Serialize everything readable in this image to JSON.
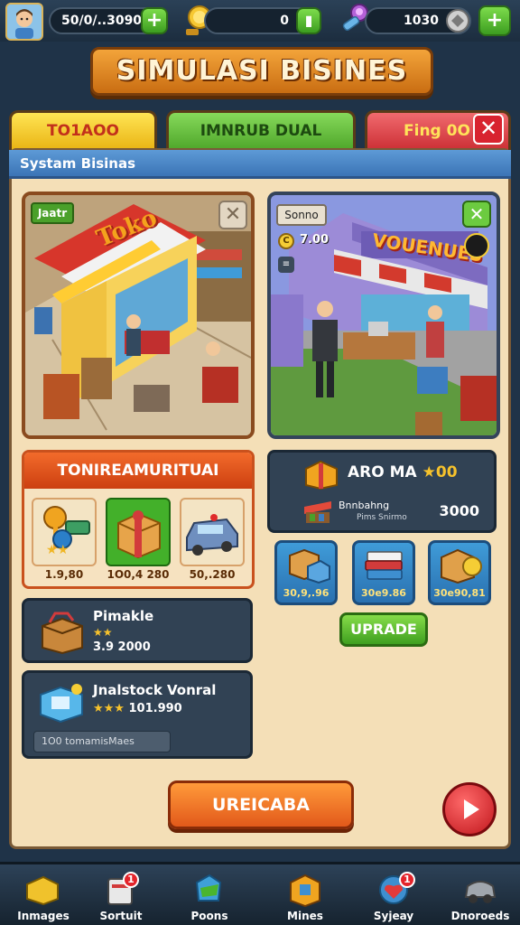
{
  "resources": {
    "cash": "50/0/..3090",
    "coins": "0",
    "gems": "1030"
  },
  "title": "SIMULASI BISINES",
  "tabs": [
    {
      "label": "TO1AOO",
      "color": "#f5d02b"
    },
    {
      "label": "IMNRUB DUAL",
      "color": "#6cc844"
    },
    {
      "label": "Fing 0O",
      "color": "#e2454a"
    }
  ],
  "subheader": "Systam Bisinas",
  "scene_left": {
    "tag": "Jaatr",
    "sign": "Toko"
  },
  "scene_right": {
    "tag": "Sonno",
    "coin_value": "7.00",
    "sign": "VOUENUES"
  },
  "feature_panel": {
    "title": "TONIREAMURITUAI",
    "items": [
      {
        "icon": "key-icon",
        "price": "1.9,80",
        "stars": "★★"
      },
      {
        "icon": "gift-box-icon",
        "price": "1O0,4 280"
      },
      {
        "icon": "car-icon",
        "price": "50,.280"
      }
    ]
  },
  "list_items": [
    {
      "title": "Pimakle",
      "stars": "★★",
      "value": "3.9 2000"
    },
    {
      "title": "Jnalstock Vonral",
      "stars": "★★★",
      "value": "101.990",
      "note": "1O0 tomamisMaes"
    }
  ],
  "right_card": {
    "title": "ARO MA",
    "title_value": "00",
    "sub_label": "Bnnbahng",
    "sub_detail": "Pims Snirmo",
    "value": "3000"
  },
  "product_tiles": [
    {
      "icon": "boxes-icon",
      "price": "30,9,.96"
    },
    {
      "icon": "books-icon",
      "price": "30e9.86"
    },
    {
      "icon": "box-coin-icon",
      "price": "30e90,81"
    }
  ],
  "upgrade_label": "UPRADE",
  "main_button": "UREICABA",
  "nav": [
    {
      "label": "Inmages",
      "badge": ""
    },
    {
      "label": "Sortuit",
      "badge": "1"
    },
    {
      "label": "Poons",
      "badge": ""
    },
    {
      "label": "Mines",
      "badge": ""
    },
    {
      "label": "Syjeay",
      "badge": "1"
    },
    {
      "label": "Dnoroeds",
      "badge": ""
    }
  ]
}
